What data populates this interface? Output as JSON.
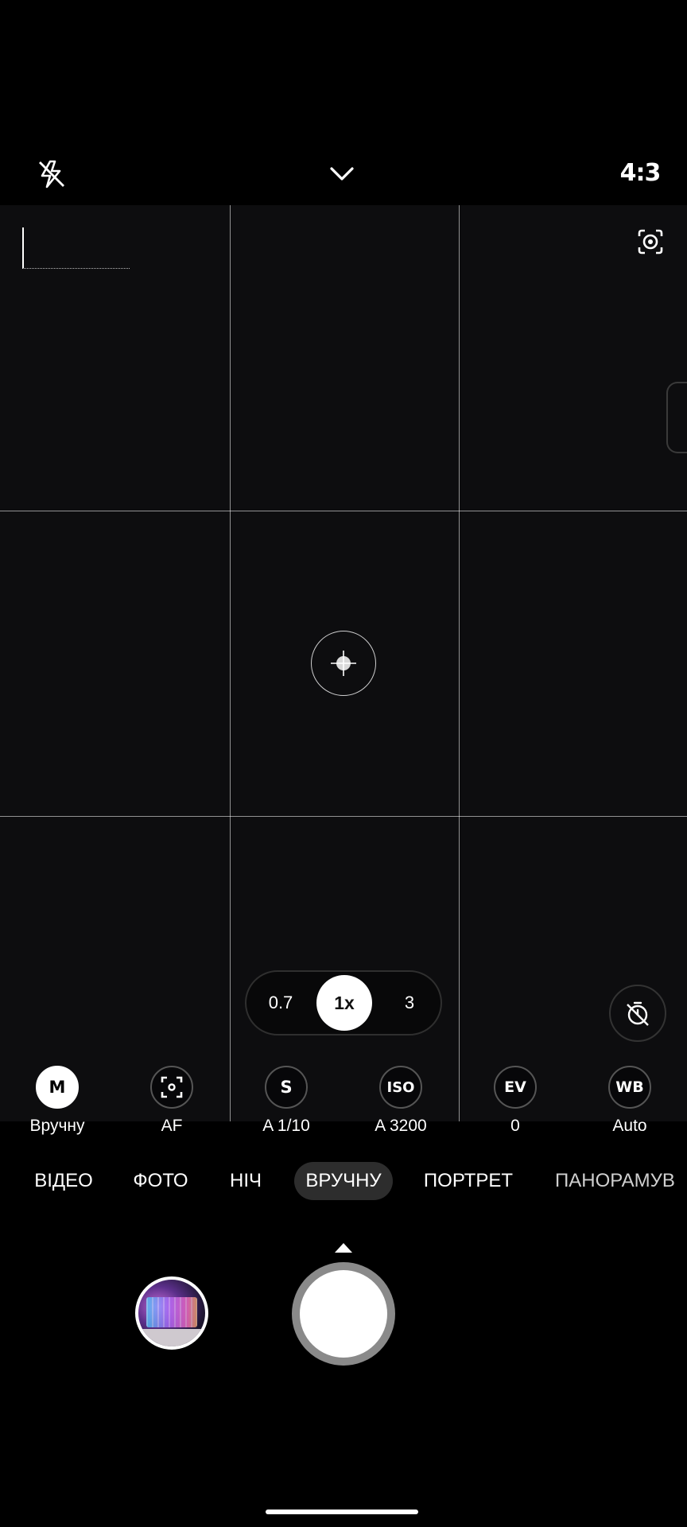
{
  "top_bar": {
    "flash_icon": "flash-off-icon",
    "expand_icon": "chevron-down-icon",
    "aspect_ratio": "4:3"
  },
  "viewfinder": {
    "screen_capture_icon": "screen-capture-icon",
    "focus_icon": "focus-target-icon"
  },
  "zoom": {
    "options": [
      "0.7",
      "1x",
      "3"
    ],
    "selected": "1x"
  },
  "timer_icon": "timer-off-icon",
  "pro_controls": [
    {
      "icon_text": "M",
      "label": "Вручну",
      "active": true
    },
    {
      "icon_text": "",
      "icon": "focus-frame-icon",
      "label": "AF",
      "active": false
    },
    {
      "icon_text": "S",
      "label": "A 1/10",
      "active": false
    },
    {
      "icon_text": "ISO",
      "label": "A 3200",
      "active": false
    },
    {
      "icon_text": "EV",
      "label": "0",
      "active": false
    },
    {
      "icon_text": "WB",
      "label": "Auto",
      "active": false
    }
  ],
  "modes": {
    "items": [
      "ВІДЕО",
      "ФОТО",
      "НІЧ",
      "ВРУЧНУ",
      "ПОРТРЕТ",
      "ПАНОРАМУВ"
    ],
    "selected": "ВРУЧНУ"
  },
  "colors": {
    "background": "#000000",
    "viewfinder": "#0d0d0f",
    "accent": "#ffffff",
    "mode_selected_bg": "#2d2d2d"
  }
}
